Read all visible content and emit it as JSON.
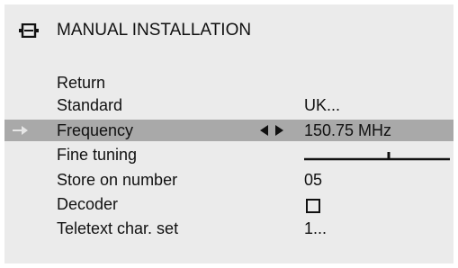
{
  "menu": {
    "title": "MANUAL INSTALLATION",
    "header_icon": "installation-icon",
    "items": [
      {
        "label": "Return",
        "value": ""
      },
      {
        "label": "Standard",
        "value": "UK..."
      },
      {
        "label": "Frequency",
        "value": "150.75 MHz",
        "selected": true,
        "selected_icon": "arrow-right-icon",
        "adjust_icon": "left-right-arrows-icon"
      },
      {
        "label": "Fine tuning",
        "value": "",
        "control": "slider",
        "level": 0.58
      },
      {
        "label": "Store on number",
        "value": "05"
      },
      {
        "label": "Decoder",
        "value": "",
        "control": "checkbox",
        "checked": false
      },
      {
        "label": "Teletext char. set",
        "value": "1..."
      }
    ]
  },
  "colors": {
    "background": "#ebebeb",
    "highlight": "#a9a9a9",
    "text": "#111111"
  }
}
